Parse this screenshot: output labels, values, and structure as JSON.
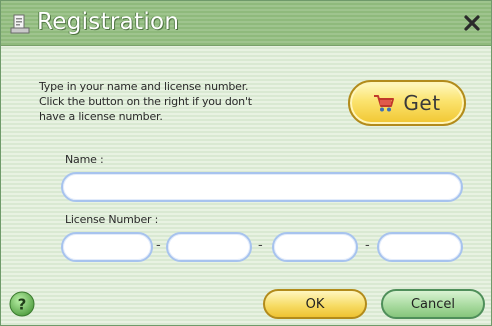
{
  "window": {
    "title": "Registration",
    "close_glyph": "✕"
  },
  "instructions": {
    "line1": "Type in your name and license number.",
    "line2": "Click the button on the right if you don't",
    "line3": "have a license number."
  },
  "get_button": {
    "label": "Get",
    "icon": "shopping-cart-icon"
  },
  "name_field": {
    "label": "Name :",
    "value": ""
  },
  "license_field": {
    "label": "License Number :",
    "separator": "-",
    "segments": [
      "",
      "",
      "",
      ""
    ]
  },
  "footer": {
    "help_glyph": "?",
    "ok_label": "OK",
    "cancel_label": "Cancel"
  },
  "colors": {
    "title_bar": "#9fc48e",
    "body_stripe": "#e8f2e2",
    "get_button": "#f7dc66",
    "ok_button": "#f7dc66",
    "cancel_button": "#a9dba0",
    "input_border": "#a7c3ee"
  }
}
